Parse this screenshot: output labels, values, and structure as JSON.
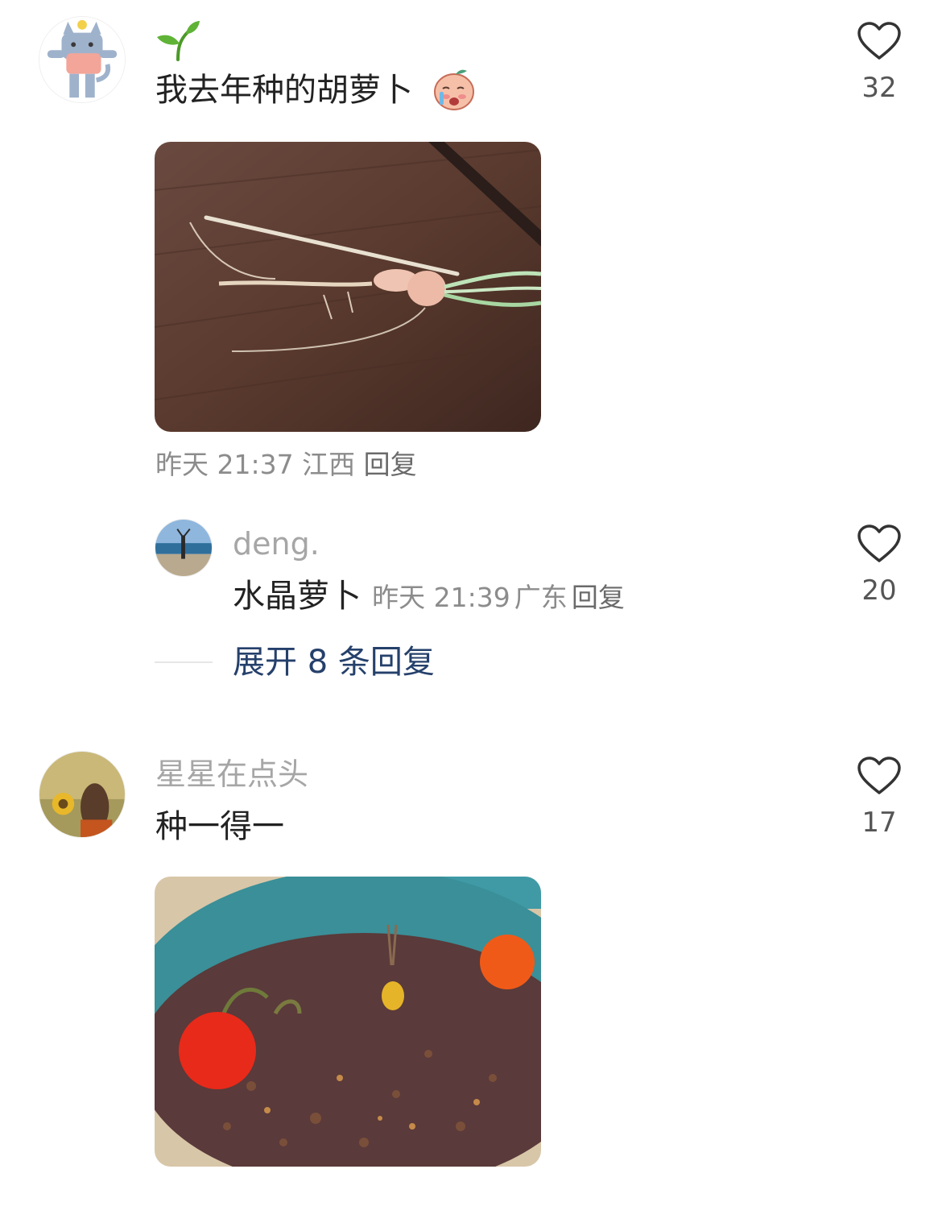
{
  "comments": [
    {
      "username_icon": "sprout-icon",
      "content": "我去年种的胡萝卜",
      "content_emoji": "crying-peach-sticker-icon",
      "meta_time": "昨天 21:37",
      "meta_location": "江西",
      "reply_label": "回复",
      "likes": "32",
      "reply": {
        "username": "deng.",
        "content": "水晶萝卜",
        "meta_time": "昨天 21:39",
        "meta_location": "广东",
        "reply_label": "回复",
        "likes": "20"
      },
      "expand_label": "展开 8 条回复"
    },
    {
      "username": "星星在点头",
      "content": "种一得一",
      "likes": "17"
    }
  ],
  "colors": {
    "username": "#a6a6a6",
    "meta": "#8c8c8c",
    "expand": "#25406b",
    "heart_outline": "#333333"
  }
}
